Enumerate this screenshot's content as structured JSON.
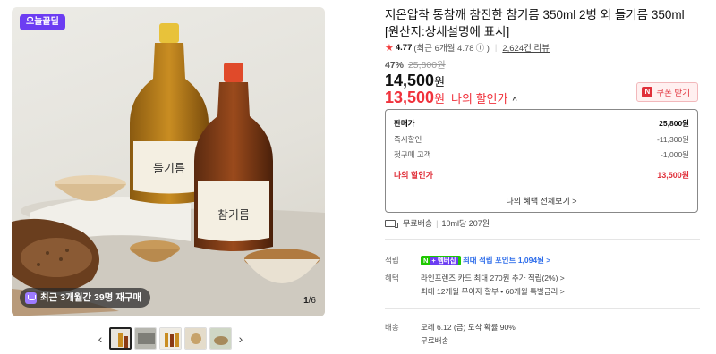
{
  "gallery": {
    "badge": "오늘끝딜",
    "stat": "최근 3개월간 39명 재구매",
    "counter_current": "1",
    "counter_total": "/6",
    "bottle_label_left": "들기름",
    "bottle_label_right": "참기름",
    "thumb_count": 5
  },
  "product": {
    "title": "저온압착 통참깨 참진한 참기름 350ml 2병 외 들기름 350ml [원산지:상세설명에 표시]",
    "rating_score": "4.77",
    "rating_recent": "(최근 6개월 4.78",
    "rating_info": "ⓘ )",
    "review_count": "2,624건 리뷰"
  },
  "price": {
    "discount_pct": "47%",
    "original": "25,800원",
    "sale": "14,500",
    "sale_unit": "원",
    "mine": "13,500",
    "mine_unit": "원",
    "mine_label": "나의 할인가",
    "caret": "^",
    "coupon_label": "쿠폰 받기"
  },
  "price_box": {
    "rows": [
      {
        "label": "판매가",
        "value": "25,800원"
      },
      {
        "label": "즉시할인",
        "value": "-11,300원"
      },
      {
        "label": "첫구매 고객",
        "value": "-1,000원"
      },
      {
        "label": "나의 할인가",
        "value": "13,500원"
      }
    ],
    "link": "나의 혜택 전체보기 >"
  },
  "shipping": {
    "free": "무료배송",
    "per_unit": "10ml당 207원"
  },
  "info": {
    "points_key": "적립",
    "points_badge_n": "N",
    "points_badge_plus": "+ 멤버십",
    "points_text": "최대 적립 포인트",
    "points_amount": "1,094원 >",
    "benefit_key": "혜택",
    "benefit_line1": "라인프렌즈 카드 최대 270원 추가 적립(2%) >",
    "benefit_line2": "최대 12개월 무이자 할부 • 60개월 특별금리 >",
    "delivery_key": "배송",
    "delivery_line1": "모레 6.12 (금) 도착 확률 90%",
    "delivery_line2": "무료배송"
  },
  "colors": {
    "accent_red": "#f0323c",
    "badge_purple": "#6c3df2",
    "npay_green": "#1ec800",
    "link_blue": "#2e6dea"
  }
}
